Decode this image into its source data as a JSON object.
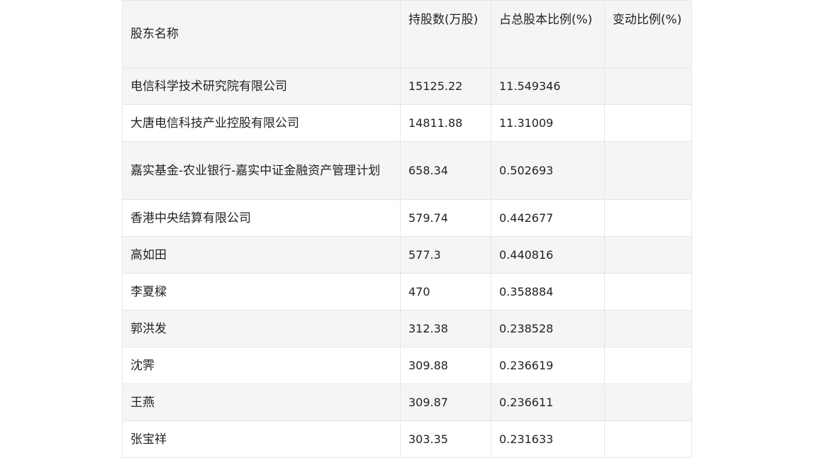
{
  "table": {
    "headers": [
      "股东名称",
      "持股数(万股)",
      "占总股本比例(%)",
      "变动比例(%)"
    ],
    "rows": [
      [
        "电信科学技术研究院有限公司",
        "15125.22",
        "11.549346",
        ""
      ],
      [
        "大唐电信科技产业控股有限公司",
        "14811.88",
        "11.31009",
        ""
      ],
      [
        "嘉实基金-农业银行-嘉实中证金融资产管理计划",
        "658.34",
        "0.502693",
        ""
      ],
      [
        "香港中央结算有限公司",
        "579.74",
        "0.442677",
        ""
      ],
      [
        "高如田",
        "577.3",
        "0.440816",
        ""
      ],
      [
        "李夏樑",
        "470",
        "0.358884",
        ""
      ],
      [
        "郭洪发",
        "312.38",
        "0.238528",
        ""
      ],
      [
        "沈霁",
        "309.88",
        "0.236619",
        ""
      ],
      [
        "王燕",
        "309.87",
        "0.236611",
        ""
      ],
      [
        "张宝祥",
        "303.35",
        "0.231633",
        ""
      ]
    ]
  }
}
